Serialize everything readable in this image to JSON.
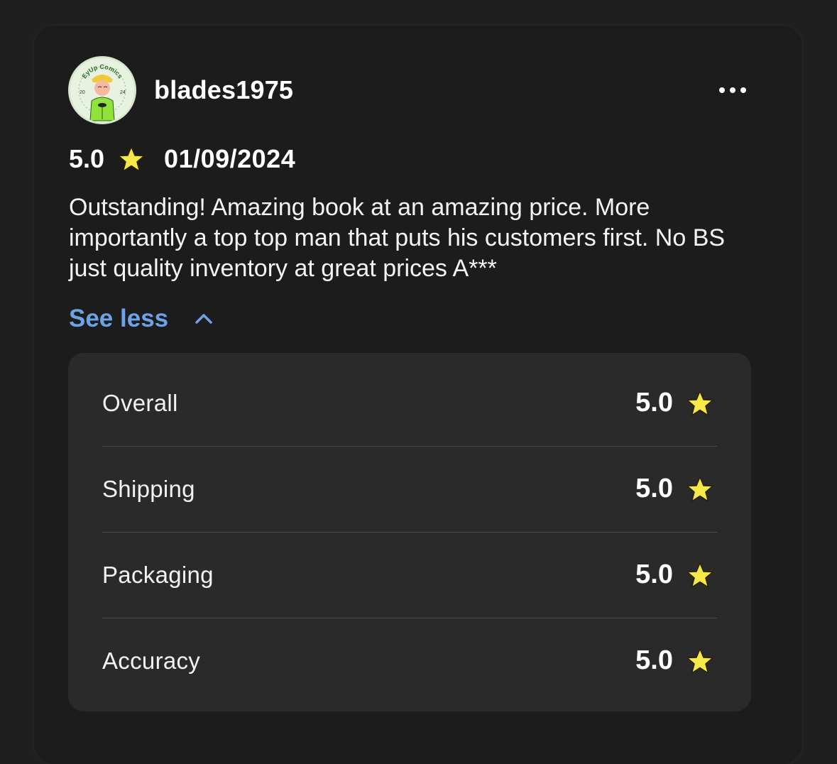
{
  "review": {
    "username": "blades1975",
    "avatar_text": "EyUp Comics",
    "avatar_year_left": "20",
    "avatar_year_right": "24",
    "rating": "5.0",
    "date": "01/09/2024",
    "body": "Outstanding! Amazing book at an amazing price. More importantly a top top man that puts his customers first. No BS just quality inventory at great prices A***",
    "see_less_label": "See less",
    "more_icon": "more-horizontal-icon"
  },
  "breakdown": [
    {
      "label": "Overall",
      "value": "5.0"
    },
    {
      "label": "Shipping",
      "value": "5.0"
    },
    {
      "label": "Packaging",
      "value": "5.0"
    },
    {
      "label": "Accuracy",
      "value": "5.0"
    }
  ],
  "colors": {
    "background": "#1f1f1f",
    "panel": "#2a2a2a",
    "star": "#f7e84a",
    "link": "#6ea2e6"
  }
}
